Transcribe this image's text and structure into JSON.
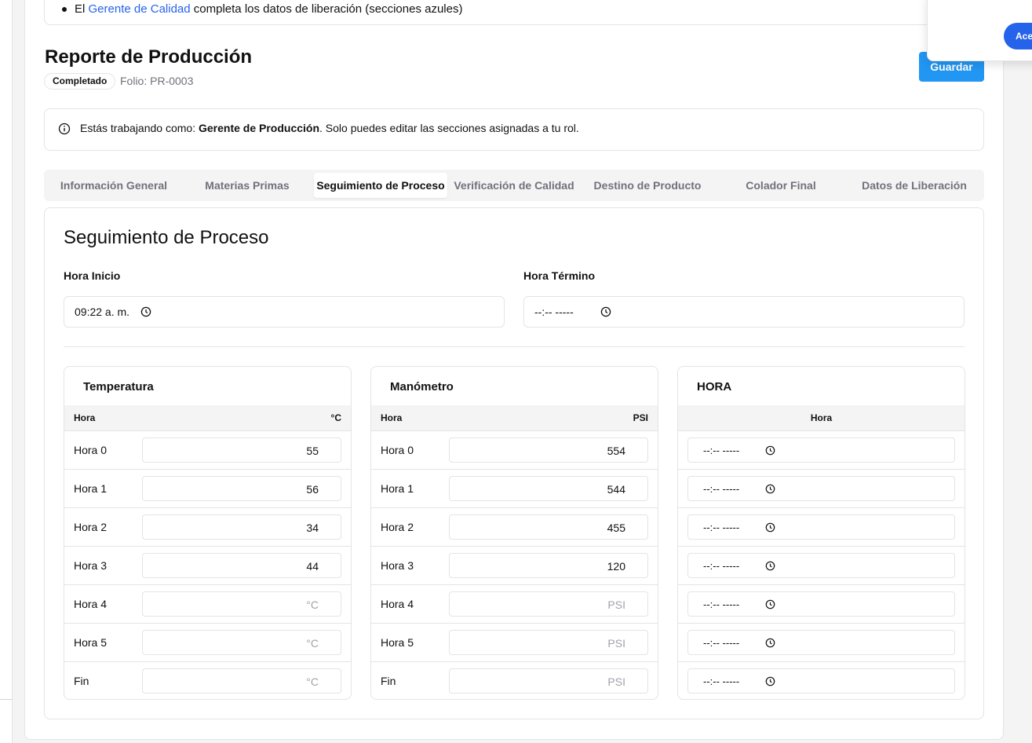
{
  "notice": {
    "prefix": "El",
    "link": "Gerente de Calidad",
    "suffix": "completa los datos de liberación (secciones azules)"
  },
  "header": {
    "title": "Reporte de Producción",
    "status": "Completado",
    "folio": "Folio: PR-0003",
    "save_label": "Guardar"
  },
  "popup": {
    "accept_label": "Acep"
  },
  "role_alert": {
    "prefix": "Estás trabajando como:",
    "role": "Gerente de Producción",
    "suffix": ". Solo puedes editar las secciones asignadas a tu rol."
  },
  "tabs": [
    {
      "label": "Información General"
    },
    {
      "label": "Materias Primas"
    },
    {
      "label": "Seguimiento de Proceso",
      "active": true
    },
    {
      "label": "Verificación de Calidad"
    },
    {
      "label": "Destino de Producto"
    },
    {
      "label": "Colador Final"
    },
    {
      "label": "Datos de Liberación"
    }
  ],
  "section": {
    "title": "Seguimiento de Proceso",
    "hora_inicio": {
      "label": "Hora Inicio",
      "value": "09:22  a. m."
    },
    "hora_termino": {
      "label": "Hora Término",
      "value": "--:--  -----"
    }
  },
  "temperatura": {
    "title": "Temperatura",
    "col_left": "Hora",
    "col_right": "°C",
    "placeholder": "°C",
    "rows": [
      {
        "label": "Hora 0",
        "value": "55"
      },
      {
        "label": "Hora 1",
        "value": "56"
      },
      {
        "label": "Hora 2",
        "value": "34"
      },
      {
        "label": "Hora 3",
        "value": "44"
      },
      {
        "label": "Hora 4",
        "value": ""
      },
      {
        "label": "Hora 5",
        "value": ""
      },
      {
        "label": "Fin",
        "value": ""
      }
    ]
  },
  "manometro": {
    "title": "Manómetro",
    "col_left": "Hora",
    "col_right": "PSI",
    "placeholder": "PSI",
    "rows": [
      {
        "label": "Hora 0",
        "value": "554"
      },
      {
        "label": "Hora 1",
        "value": "544"
      },
      {
        "label": "Hora 2",
        "value": "455"
      },
      {
        "label": "Hora 3",
        "value": "120"
      },
      {
        "label": "Hora 4",
        "value": ""
      },
      {
        "label": "Hora 5",
        "value": ""
      },
      {
        "label": "Fin",
        "value": ""
      }
    ]
  },
  "hora": {
    "title": "HORA",
    "col": "Hora",
    "rows": [
      {
        "value": "--:--  -----"
      },
      {
        "value": "--:--  -----"
      },
      {
        "value": "--:--  -----"
      },
      {
        "value": "--:--  -----"
      },
      {
        "value": "--:--  -----"
      },
      {
        "value": "--:--  -----"
      },
      {
        "value": "--:--  -----"
      }
    ]
  }
}
